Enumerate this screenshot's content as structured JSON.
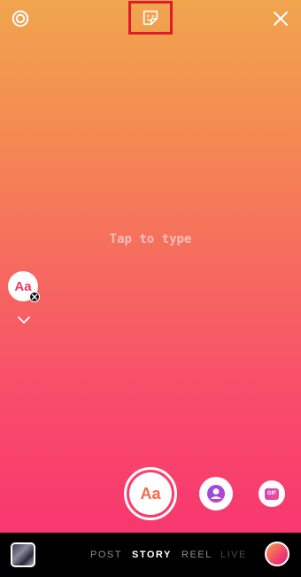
{
  "canvas": {
    "placeholder": "Tap to type",
    "gradient_top": "#f0a54d",
    "gradient_bottom": "#f8376f"
  },
  "top_bar": {
    "settings_icon": "gear-icon",
    "sticker_icon": "sticker-icon",
    "close_icon": "close-icon",
    "highlight_color": "#e21b2b"
  },
  "side_tools": {
    "text_style_label": "Aa",
    "remove_icon": "close-small-icon",
    "expand_icon": "chevron-down-icon"
  },
  "capture": {
    "text_mode_label": "Aa"
  },
  "quick_actions": {
    "mention_icon": "user-icon",
    "gif_label": "GIF"
  },
  "bottom_bar": {
    "modes": [
      "POST",
      "STORY",
      "REEL",
      "LIVE"
    ],
    "active_mode": "STORY",
    "gallery_icon": "gallery-thumbnail"
  }
}
